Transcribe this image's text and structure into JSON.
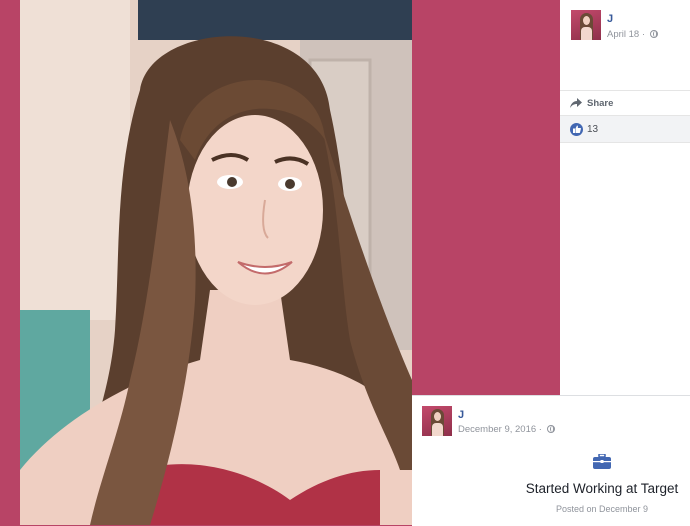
{
  "post": {
    "author": "J",
    "date": "April 18 · ",
    "share_label": "Share",
    "like_count": "13"
  },
  "life_event": {
    "author": "J",
    "date": "December 9, 2016 · ",
    "title": "Started Working at Target",
    "subtitle": "Posted on December 9"
  },
  "colors": {
    "background": "#b84466",
    "link_blue": "#365899",
    "like_blue": "#4267b2",
    "meta_gray": "#90949c"
  },
  "icons": {
    "privacy": "globe-icon",
    "share": "share-arrow-icon",
    "like": "thumbs-up-icon",
    "event": "briefcase-icon"
  }
}
